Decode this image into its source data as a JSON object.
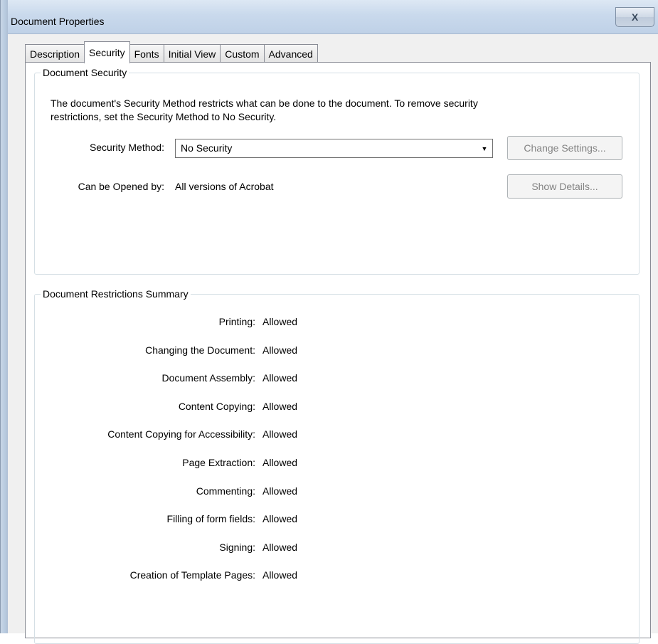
{
  "window": {
    "title": "Document Properties",
    "close_glyph": "X"
  },
  "tabs": [
    {
      "label": "Description",
      "active": false
    },
    {
      "label": "Security",
      "active": true
    },
    {
      "label": "Fonts",
      "active": false
    },
    {
      "label": "Initial View",
      "active": false
    },
    {
      "label": "Custom",
      "active": false
    },
    {
      "label": "Advanced",
      "active": false
    }
  ],
  "security_group": {
    "legend": "Document Security",
    "description_line1": "The document's Security Method restricts what can be done to the document. To remove security",
    "description_line2": "restrictions, set the Security Method to No Security.",
    "method_label": "Security Method:",
    "method_value": "No Security",
    "dropdown_icon": "chevron-down-icon",
    "change_settings_label": "Change Settings...",
    "opened_by_label": "Can be Opened by:",
    "opened_by_value": "All versions of Acrobat",
    "show_details_label": "Show Details..."
  },
  "restrictions_group": {
    "legend": "Document Restrictions Summary",
    "rows": [
      {
        "label": "Printing:",
        "value": "Allowed"
      },
      {
        "label": "Changing the Document:",
        "value": "Allowed"
      },
      {
        "label": "Document Assembly:",
        "value": "Allowed"
      },
      {
        "label": "Content Copying:",
        "value": "Allowed"
      },
      {
        "label": "Content Copying for Accessibility:",
        "value": "Allowed"
      },
      {
        "label": "Page Extraction:",
        "value": "Allowed"
      },
      {
        "label": "Commenting:",
        "value": "Allowed"
      },
      {
        "label": "Filling of form fields:",
        "value": "Allowed"
      },
      {
        "label": "Signing:",
        "value": "Allowed"
      },
      {
        "label": "Creation of Template Pages:",
        "value": "Allowed"
      }
    ]
  },
  "colors": {
    "titlebar": "#c9d9ec",
    "group_border": "#d5dfe5",
    "disabled_text": "#838383"
  }
}
